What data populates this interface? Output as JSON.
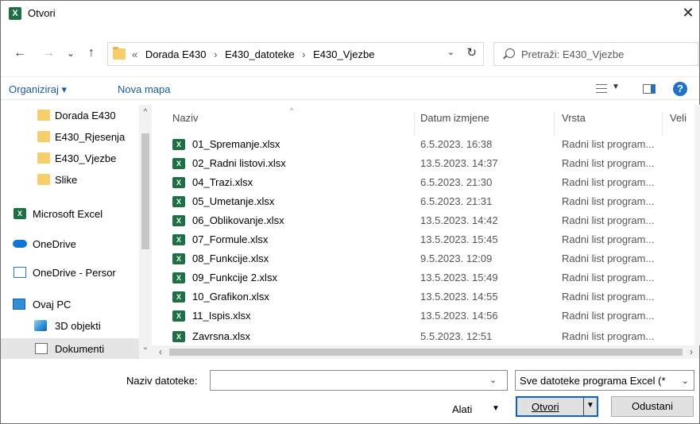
{
  "window": {
    "title": "Otvori",
    "app_badge": "X",
    "close_glyph": "✕"
  },
  "nav": {
    "back_glyph": "←",
    "forward_glyph": "→",
    "recent_glyph": "⌄",
    "up_glyph": "↑",
    "breadcrumb": [
      "«",
      "Dorada E430",
      "›",
      "E430_datoteke",
      "›",
      "E430_Vjezbe"
    ],
    "refresh_glyph": "↻",
    "search_placeholder": "Pretraži: E430_Vjezbe"
  },
  "toolbar": {
    "organize_label": "Organiziraj ▾",
    "new_folder_label": "Nova mapa",
    "help_glyph": "?"
  },
  "sidebar": {
    "items": [
      {
        "label": "Dorada E430",
        "icon": "folder-icon"
      },
      {
        "label": "E430_Rjesenja",
        "icon": "folder-icon"
      },
      {
        "label": "E430_Vjezbe",
        "icon": "folder-icon"
      },
      {
        "label": "Slike",
        "icon": "folder-icon"
      },
      {
        "label": "Microsoft Excel",
        "icon": "excel-icon"
      },
      {
        "label": "OneDrive",
        "icon": "cloud-icon"
      },
      {
        "label": "OneDrive - Persor",
        "icon": "onedrive-personal-icon"
      },
      {
        "label": "Ovaj PC",
        "icon": "computer-icon"
      },
      {
        "label": "3D objekti",
        "icon": "3d-objects-icon"
      },
      {
        "label": "Dokumenti",
        "icon": "documents-icon"
      }
    ]
  },
  "files": {
    "columns": {
      "name": "Naziv",
      "date": "Datum izmjene",
      "type": "Vrsta",
      "size": "Veli"
    },
    "rows": [
      {
        "name": "01_Spremanje.xlsx",
        "date": "6.5.2023. 16:38",
        "type": "Radni list program..."
      },
      {
        "name": "02_Radni listovi.xlsx",
        "date": "13.5.2023. 14:37",
        "type": "Radni list program..."
      },
      {
        "name": "04_Trazi.xlsx",
        "date": "6.5.2023. 21:30",
        "type": "Radni list program..."
      },
      {
        "name": "05_Umetanje.xlsx",
        "date": "6.5.2023. 21:31",
        "type": "Radni list program..."
      },
      {
        "name": "06_Oblikovanje.xlsx",
        "date": "13.5.2023. 14:42",
        "type": "Radni list program..."
      },
      {
        "name": "07_Formule.xlsx",
        "date": "13.5.2023. 15:45",
        "type": "Radni list program..."
      },
      {
        "name": "08_Funkcije.xlsx",
        "date": "9.5.2023. 12:09",
        "type": "Radni list program..."
      },
      {
        "name": "09_Funkcije 2.xlsx",
        "date": "13.5.2023. 15:49",
        "type": "Radni list program..."
      },
      {
        "name": "10_Grafikon.xlsx",
        "date": "13.5.2023. 14:55",
        "type": "Radni list program..."
      },
      {
        "name": "11_Ispis.xlsx",
        "date": "13.5.2023. 14:56",
        "type": "Radni list program..."
      },
      {
        "name": "Zavrsna.xlsx",
        "date": "5.5.2023. 12:51",
        "type": "Radni list program..."
      }
    ]
  },
  "footer": {
    "filename_label": "Naziv datoteke:",
    "filename_value": "",
    "filter_value": "Sve datoteke programa Excel (*",
    "tools_label": "Alati",
    "open_label": "Otvori",
    "cancel_label": "Odustani"
  },
  "colors": {
    "accent": "#0a64c8",
    "excel_green": "#1d7044",
    "link_blue": "#1a5c98",
    "folder": "#f6cf6b"
  }
}
